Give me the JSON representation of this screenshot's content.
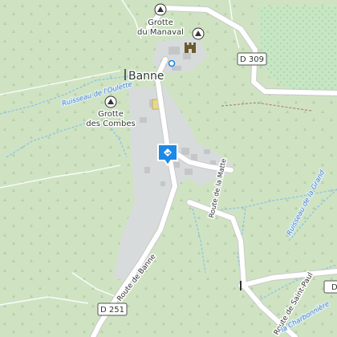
{
  "map": {
    "town": "Banne",
    "places": [
      {
        "name": "Grotte",
        "name2": "du Manaval"
      },
      {
        "name": "Grotte",
        "name2": "des Combes"
      }
    ],
    "roads": {
      "d309": "D 309",
      "d251": "D 251",
      "route_de_banne": "Route de Banne",
      "route_de_la_matte": "Route de la Matte",
      "route_de_saint_paul": "Route de Saint-Paul",
      "d_edge": "D"
    },
    "streams": {
      "oulette": "Ruisseau de l'Oulette",
      "grand": "Ruisseau de la Grand",
      "charbonniere": "la Charbonnière"
    },
    "colors": {
      "land": "#cfe3c3",
      "forest_dot": "#b7d1aa",
      "village": "#d9dcdd",
      "vineyard": "#bfe0c0",
      "road": "#ffffff",
      "stream": "#8bc6e8",
      "pin": "#1e88e5"
    },
    "icons": [
      "cave-icon",
      "castle-icon",
      "viewpoint-icon",
      "location-pin-icon"
    ]
  }
}
